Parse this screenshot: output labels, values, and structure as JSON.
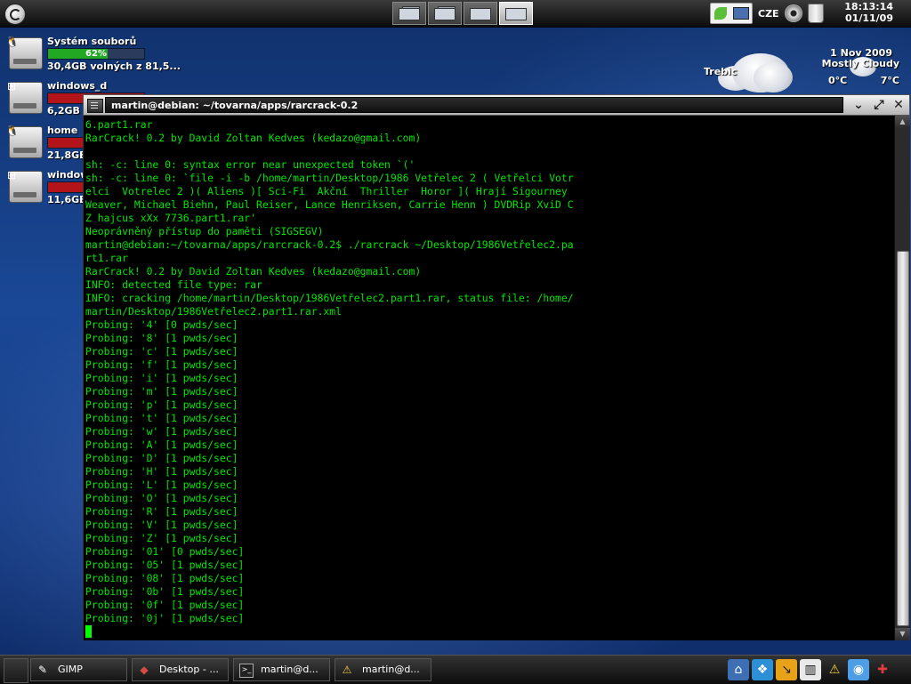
{
  "top_panel": {
    "clock_time": "18:13:14",
    "clock_date": "01/11/09",
    "keyboard_layout": "CZE",
    "pager_desktops": [
      "Desktop 1",
      "Desktop 2",
      "Desktop 3",
      "Desktop 4"
    ],
    "active_desktop": 4,
    "tray_icons": [
      "network-manager-icon",
      "monitor-icon",
      "cdrom-icon",
      "trash-icon"
    ]
  },
  "desktop_icons": [
    {
      "name": "Systém souborů",
      "bar_label": "62%",
      "usage_fraction": 0.62,
      "bar_color": "#23a824",
      "size_text": "30,4GB volných z 81,5...",
      "os_badge": "linux-icon"
    },
    {
      "name": "windows_d",
      "bar_label": "",
      "usage_fraction": 1.0,
      "bar_color": "#b3141a",
      "size_text": "6,2GB v",
      "os_badge": "windows-icon"
    },
    {
      "name": "home",
      "bar_label": "",
      "usage_fraction": 1.0,
      "bar_color": "#b3141a",
      "size_text": "21,8GB",
      "os_badge": "linux-icon"
    },
    {
      "name": "window",
      "bar_label": "",
      "usage_fraction": 1.0,
      "bar_color": "#b3141a",
      "size_text": "11,6GB",
      "os_badge": "windows-icon"
    }
  ],
  "weather": {
    "city": "Trebic",
    "date": "1 Nov 2009",
    "condition": "Mostly Cloudy",
    "low": "0°C",
    "high": "7°C"
  },
  "terminal": {
    "title": "martin@debian: ~/tovarna/apps/rarcrack-0.2",
    "lines": [
      "6.part1.rar",
      "RarCrack! 0.2 by David Zoltan Kedves (kedazo@gmail.com)",
      "",
      "sh: -c: line 0: syntax error near unexpected token `('",
      "sh: -c: line 0: `file -i -b /home/martin/Desktop/1986 Vetřelec 2 ( Vetřelci Votr",
      "elci  Votrelec 2 )( Aliens )[ Sci-Fi  Akční  Thriller  Horor ]( Hrají Sigourney",
      "Weaver, Michael Biehn, Paul Reiser, Lance Henriksen, Carrie Henn ) DVDRip XviD C",
      "Z hajcus xXx 7736.part1.rar'",
      "Neoprávněný přístup do paměti (SIGSEGV)",
      "martin@debian:~/tovarna/apps/rarcrack-0.2$ ./rarcrack ~/Desktop/1986Vetřelec2.pa",
      "rt1.rar",
      "RarCrack! 0.2 by David Zoltan Kedves (kedazo@gmail.com)",
      "INFO: detected file type: rar",
      "INFO: cracking /home/martin/Desktop/1986Vetřelec2.part1.rar, status file: /home/",
      "martin/Desktop/1986Vetřelec2.part1.rar.xml",
      "Probing: '4' [0 pwds/sec]",
      "Probing: '8' [1 pwds/sec]",
      "Probing: 'c' [1 pwds/sec]",
      "Probing: 'f' [1 pwds/sec]",
      "Probing: 'i' [1 pwds/sec]",
      "Probing: 'm' [1 pwds/sec]",
      "Probing: 'p' [1 pwds/sec]",
      "Probing: 't' [1 pwds/sec]",
      "Probing: 'w' [1 pwds/sec]",
      "Probing: 'A' [1 pwds/sec]",
      "Probing: 'D' [1 pwds/sec]",
      "Probing: 'H' [1 pwds/sec]",
      "Probing: 'L' [1 pwds/sec]",
      "Probing: 'O' [1 pwds/sec]",
      "Probing: 'R' [1 pwds/sec]",
      "Probing: 'V' [1 pwds/sec]",
      "Probing: 'Z' [1 pwds/sec]",
      "Probing: '01' [0 pwds/sec]",
      "Probing: '05' [1 pwds/sec]",
      "Probing: '08' [1 pwds/sec]",
      "Probing: '0b' [1 pwds/sec]",
      "Probing: '0f' [1 pwds/sec]",
      "Probing: '0j' [1 pwds/sec]"
    ],
    "text_color": "#00e600",
    "scrollbar_fraction": 0.72
  },
  "taskbar": {
    "tasks": [
      {
        "label": "GIMP",
        "icon": "gimp-icon"
      },
      {
        "label": "Desktop - ...",
        "icon": "desktop-icon"
      },
      {
        "label": "martin@d...",
        "icon": "terminal-icon"
      },
      {
        "label": "martin@d...",
        "icon": "warning-icon"
      }
    ],
    "launchers": [
      "home-icon",
      "dropbox-icon",
      "script-icon",
      "keyboard-icon",
      "warning-icon",
      "network-icon",
      "puzzle-icon"
    ]
  }
}
